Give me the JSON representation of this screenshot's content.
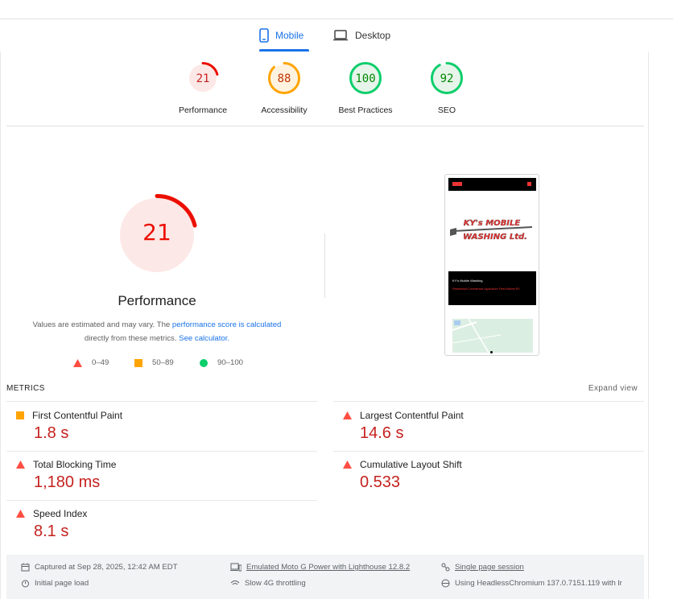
{
  "tabs": {
    "mobile": {
      "label": "Mobile",
      "icon": "smartphone-icon"
    },
    "desktop": {
      "label": "Desktop",
      "icon": "laptop-icon"
    }
  },
  "categories": [
    {
      "name": "Performance",
      "score": "21",
      "level": 0.21,
      "color": "#eb0f00",
      "bg": "#fce8e6"
    },
    {
      "name": "Accessibility",
      "score": "88",
      "level": 0.88,
      "color": "#ffa400",
      "bg": "#fff3e0"
    },
    {
      "name": "Best Practices",
      "score": "100",
      "level": 1.0,
      "color": "#0cce6b",
      "bg": "#e6f4ea"
    },
    {
      "name": "SEO",
      "score": "92",
      "level": 0.92,
      "color": "#0cce6b",
      "bg": "#e6f4ea"
    }
  ],
  "main_score": {
    "value": "21",
    "level": 0.21,
    "title": "Performance"
  },
  "note": {
    "prefix": "Values are estimated and may vary. The ",
    "link1": "performance score is calculated",
    "middle": "directly from these metrics. ",
    "link2": "See calculator."
  },
  "legend": [
    {
      "range": "0–49",
      "color": "#ff4e42",
      "icon": "triangle-icon"
    },
    {
      "range": "50–89",
      "color": "#ffa400",
      "icon": "square-icon"
    },
    {
      "range": "90–100",
      "color": "#0cce6b",
      "icon": "circle-icon"
    }
  ],
  "screenshot": {
    "logo_line1": "KY's MOBILE",
    "logo_line2": "WASHING Ltd.",
    "hero_title": "KY's Mobile Washing",
    "hero_text": "Residential·Commercial·Agriculture·Fleet Marine RV"
  },
  "metrics": {
    "header": "METRICS",
    "expand": "Expand view",
    "items": [
      {
        "name": "First Contentful Paint",
        "value": "1.8 s",
        "rating": "average"
      },
      {
        "name": "Largest Contentful Paint",
        "value": "14.6 s",
        "rating": "fail"
      },
      {
        "name": "Total Blocking Time",
        "value": "1,180 ms",
        "rating": "fail"
      },
      {
        "name": "Cumulative Layout Shift",
        "value": "0.533",
        "rating": "fail"
      },
      {
        "name": "Speed Index",
        "value": "8.1 s",
        "rating": "fail"
      }
    ]
  },
  "footer": {
    "captured": "Captured at Sep 28, 2025, 12:42 AM EDT",
    "device": "Emulated Moto G Power with Lighthouse 12.8.2",
    "session": "Single page session",
    "initial": "Initial page load",
    "throttling": "Slow 4G throttling",
    "browser": "Using HeadlessChromium 137.0.7151.119 with lr"
  },
  "colors": {
    "fail": "#ff4e42",
    "average": "#ffa400",
    "pass": "#0cce6b",
    "accent": "#1a73e8",
    "value_red": "#c5221f"
  }
}
